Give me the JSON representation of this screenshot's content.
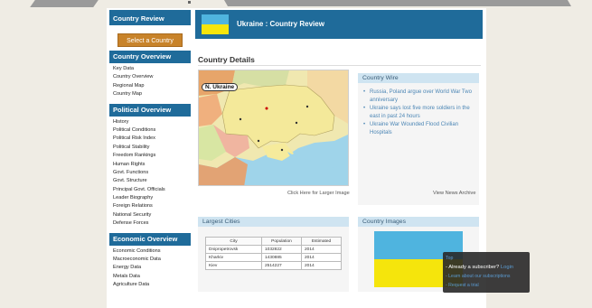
{
  "sidebar": {
    "header": "Country Review",
    "select_button": "Select a Country",
    "sections": [
      {
        "title": "Country Overview",
        "items": [
          "Key Data",
          "Country Overview",
          "Regional Map",
          "Country Map"
        ]
      },
      {
        "title": "Political Overview",
        "items": [
          "History",
          "Political Conditions",
          "Political Risk Index",
          "Political Stability",
          "Freedom Rankings",
          "Human Rights",
          "Govt. Functions",
          "Govt. Structure",
          "Principal Govt. Officials",
          "Leader Biography",
          "Foreign Relations",
          "National Security",
          "Defense Forces"
        ]
      },
      {
        "title": "Economic Overview",
        "items": [
          "Economic Conditions",
          "Macroeconomic Data",
          "Energy Data",
          "Metals Data",
          "Agriculture Data"
        ]
      }
    ]
  },
  "header": {
    "title": "Ukraine : Country Review"
  },
  "country_details": {
    "title": "Country Details",
    "map_label": "N. Ukraine",
    "larger_image_link": "Click Here for Larger Image"
  },
  "country_wire": {
    "title": "Country Wire",
    "items": [
      "Russia, Poland argue over World War Two anniversary",
      "Ukraine says lost five more soldiers in the east in past 24 hours",
      "Ukraine War Wounded Flood Civilian Hospitals"
    ],
    "archive_link": "View News Archive"
  },
  "largest_cities": {
    "title": "Largest Cities",
    "columns": [
      "City",
      "Population",
      "Estimated"
    ],
    "rows": [
      [
        "Dnipropetrovsk",
        "1032822",
        "2014"
      ],
      [
        "Kharkiv",
        "1430885",
        "2014"
      ],
      [
        "Kiev",
        "2514227",
        "2014"
      ]
    ]
  },
  "country_images": {
    "title": "Country Images"
  },
  "tooltip": {
    "top": "Top",
    "subscriber_prefix": "- Already a subscriber? ",
    "login": "Login",
    "learn": "- Learn about our subscriptions",
    "trial": "- Request a trial"
  },
  "colors": {
    "header_blue": "#1f6b9a",
    "button_orange": "#c8832a",
    "flag_blue": "#4fb4df",
    "flag_yellow": "#f5e50c",
    "link_blue": "#4c86b5"
  }
}
